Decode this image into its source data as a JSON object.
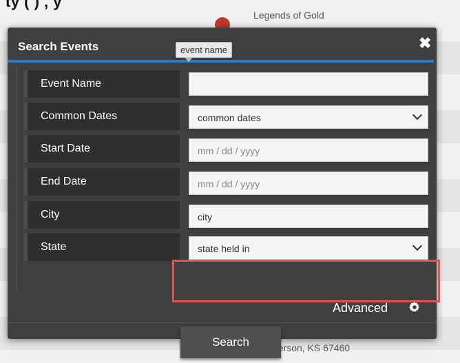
{
  "background": {
    "top_text": "ty                               (                    ) , y",
    "listing_top": "Legends of Gold",
    "listing_bottom": "McPherson, KS 67460"
  },
  "dialog": {
    "title": "Search Events",
    "close_label": "✖",
    "tooltip": "event name",
    "fields": [
      {
        "label": "Event Name",
        "value": "",
        "placeholder": ""
      },
      {
        "label": "Common Dates",
        "value": "common dates",
        "type": "select"
      },
      {
        "label": "Start Date",
        "placeholder": "mm  /  dd  /  yyyy"
      },
      {
        "label": "End Date",
        "placeholder": "mm  /  dd  /  yyyy"
      },
      {
        "label": "City",
        "value": "city"
      },
      {
        "label": "State",
        "value": "state held in",
        "type": "select"
      }
    ],
    "advanced_label": "Advanced",
    "search_label": "Search"
  },
  "colors": {
    "accent": "#2f78bd",
    "highlight": "#e05555",
    "dialog_bg": "#3f3f3f"
  }
}
